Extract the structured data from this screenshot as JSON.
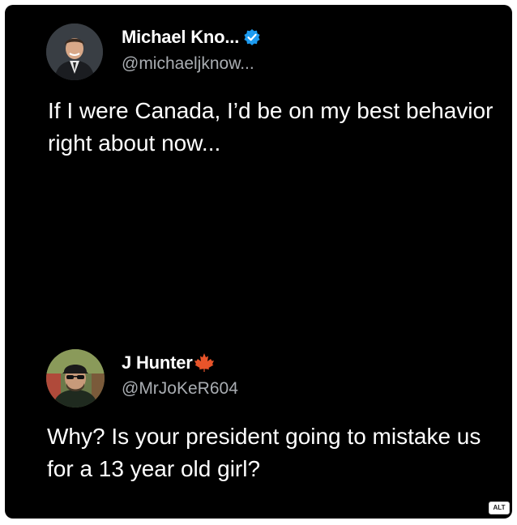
{
  "posts": [
    {
      "display_name": "Michael Kno...",
      "handle": "@michaeljknow...",
      "verified": true,
      "avatar_icon": "profile-photo-man-in-suit",
      "text": "If I were Canada, I’d be on my best behavior right about now..."
    },
    {
      "display_name": "J Hunter",
      "handle": "@MrJoKeR604",
      "name_emoji": "maple-leaf-icon",
      "avatar_icon": "profile-photo-man-with-cap-and-sunglasses",
      "text": "Why? Is your president going to mistake us for a 13 year old girl?"
    }
  ],
  "alt_badge": "ALT",
  "colors": {
    "background": "#000000",
    "primary_text": "#ffffff",
    "secondary_text": "#a9adb2",
    "verified_badge": "#1d9bf0",
    "maple_leaf": "#e8542a"
  }
}
